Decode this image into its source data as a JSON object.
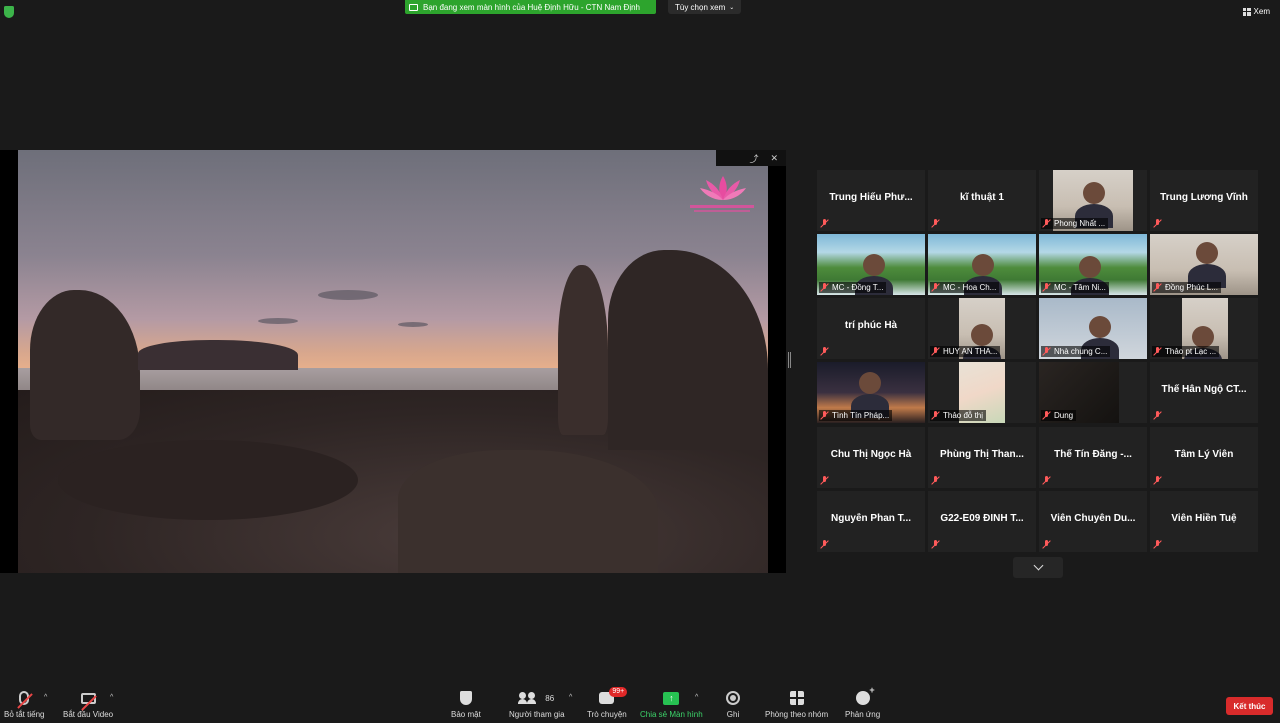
{
  "topbar": {
    "share_banner": "Bạn đang xem màn hình của Huệ Định Hữu - CTN  Nam Định",
    "view_options": "Tùy chọn xem",
    "view_toggle": "Xem"
  },
  "gallery": {
    "tiles": [
      {
        "name": "Trung  Hiếu  Phư...",
        "label": ""
      },
      {
        "name": "kĩ thuật 1",
        "label": ""
      },
      {
        "name": "",
        "label": "Phong Nhất ..."
      },
      {
        "name": "Trung Lương Vĩnh",
        "label": ""
      },
      {
        "name": "",
        "label": "MC - Đồng T..."
      },
      {
        "name": "",
        "label": "MC - Hoa Ch..."
      },
      {
        "name": "",
        "label": "MC - Tâm Ni..."
      },
      {
        "name": "",
        "label": "Đồng Phúc L..."
      },
      {
        "name": "trí phúc Hà",
        "label": ""
      },
      {
        "name": "",
        "label": "HUY AN THA..."
      },
      {
        "name": "",
        "label": "Nhà chung C..."
      },
      {
        "name": "",
        "label": "Thảo pt Lạc ..."
      },
      {
        "name": "",
        "label": "Tình Tín Pháp..."
      },
      {
        "name": "",
        "label": "Thảo đỗ thị"
      },
      {
        "name": "",
        "label": "Dung"
      },
      {
        "name": "Thế Hân Ngộ CT...",
        "label": ""
      },
      {
        "name": "Chu Thị Ngọc Hà",
        "label": ""
      },
      {
        "name": "Phùng Thị Than...",
        "label": ""
      },
      {
        "name": "Thế Tín Đăng -...",
        "label": ""
      },
      {
        "name": "Tâm Lý Viên",
        "label": ""
      },
      {
        "name": "Nguyễn Phan T...",
        "label": ""
      },
      {
        "name": "G22-E09 ĐINH T...",
        "label": ""
      },
      {
        "name": "Viên  Chuyên  Du...",
        "label": ""
      },
      {
        "name": "Viên Hiền Tuệ",
        "label": ""
      }
    ]
  },
  "toolbar": {
    "mute": "Bỏ tắt tiếng",
    "video": "Bắt đầu Video",
    "security": "Bảo mật",
    "participants": "Người tham gia",
    "participants_count": "86",
    "chat": "Trò chuyện",
    "chat_badge": "99+",
    "share": "Chia sẻ Màn hình",
    "record": "Ghi",
    "breakout": "Phòng theo nhóm",
    "reactions": "Phản ứng",
    "end": "Kết thúc"
  },
  "colors": {
    "share_green": "#2da42d",
    "end_red": "#d82b2b",
    "active_speaker": "#c9e27a",
    "mute_red": "#ff5a5a"
  }
}
